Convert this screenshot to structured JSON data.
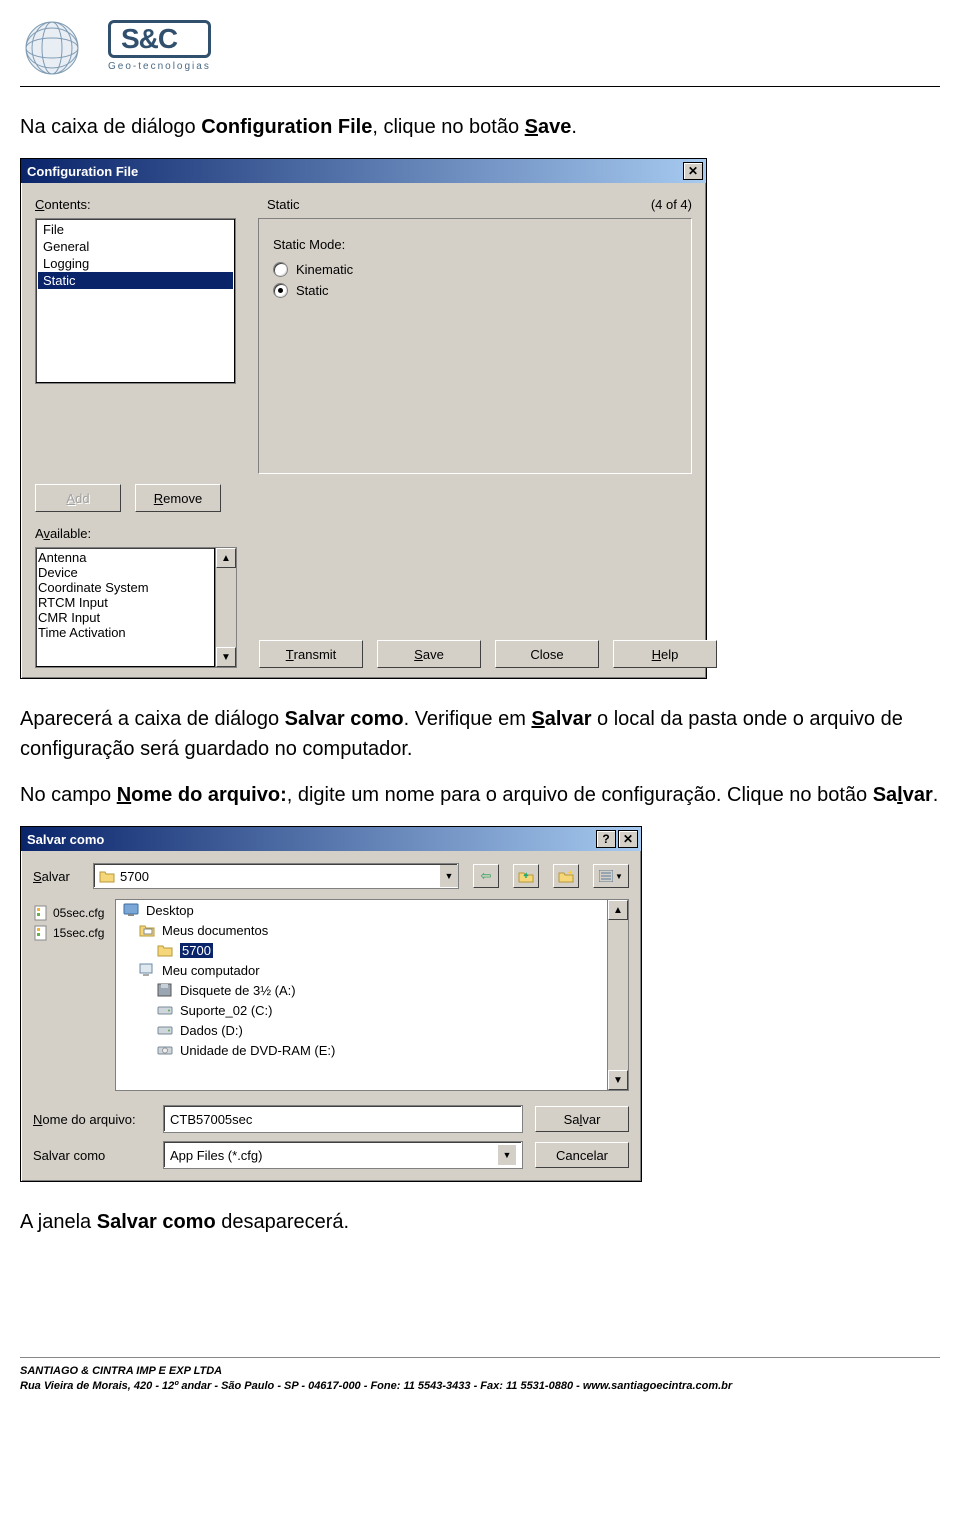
{
  "logo": {
    "name": "S&C",
    "sub": "Geo-tecnologias"
  },
  "doc": {
    "p1a": "Na caixa de diálogo ",
    "p1b": "Configuration File",
    "p1c": ", clique no botão ",
    "p1d": "S",
    "p1e": "ave",
    "p1f": ".",
    "p2a": "Aparecerá a caixa de diálogo ",
    "p2b": "Salvar como",
    "p2c": ". Verifique em ",
    "p2d": "S",
    "p2e": "alvar",
    "p2f": " o local da pasta onde o arquivo de configuração será guardado no computador.",
    "p3a": "No campo ",
    "p3b": "N",
    "p3c": "ome do arquivo:",
    "p3d": ", digite um nome para o arquivo de configuração. Clique no botão ",
    "p3e": "Sa",
    "p3f": "l",
    "p3g": "var",
    "p3h": ".",
    "p4a": "A janela ",
    "p4b": "Salvar como",
    "p4c": " desaparecerá."
  },
  "cfg": {
    "title": "Configuration File",
    "labels": {
      "contents": "Contents:",
      "static": "Static",
      "counter": "(4 of 4)",
      "static_mode": "Static Mode:",
      "available": "Available:"
    },
    "contents": [
      "File",
      "General",
      "Logging",
      "Static"
    ],
    "contents_selected": 3,
    "radios": {
      "kinematic": "Kinematic",
      "static": "Static"
    },
    "available": [
      "Antenna",
      "Device",
      "Coordinate System",
      "RTCM Input",
      "CMR Input",
      "Time Activation"
    ],
    "btns": {
      "add": "Add",
      "remove": "Remove",
      "transmit": "Transmit",
      "save": "Save",
      "close": "Close",
      "help": "Help"
    }
  },
  "save": {
    "title": "Salvar como",
    "salvar_lbl": "Salvar",
    "combo_value": "5700",
    "left_files": [
      "05sec.cfg",
      "15sec.cfg"
    ],
    "tree": [
      "Desktop",
      "Meus documentos",
      "5700",
      "Meu computador",
      "Disquete de 3½ (A:)",
      "Suporte_02 (C:)",
      "Dados (D:)",
      "Unidade de DVD-RAM (E:)"
    ],
    "tree_selected": 2,
    "nome_lbl": "Nome do arquivo:",
    "nome_value": "CTB57005sec",
    "tipo_lbl": "Salvar como",
    "tipo_value": "App Files (*.cfg)",
    "btn_save": "Salvar",
    "btn_cancel": "Cancelar"
  },
  "footer": {
    "l1": "SANTIAGO & CINTRA IMP E EXP LTDA",
    "l2": "Rua Vieira de Morais, 420 - 12º andar - São Paulo - SP - 04617-000 - Fone: 11 5543-3433 - Fax: 11 5531-0880 - www.santiagoecintra.com.br"
  }
}
